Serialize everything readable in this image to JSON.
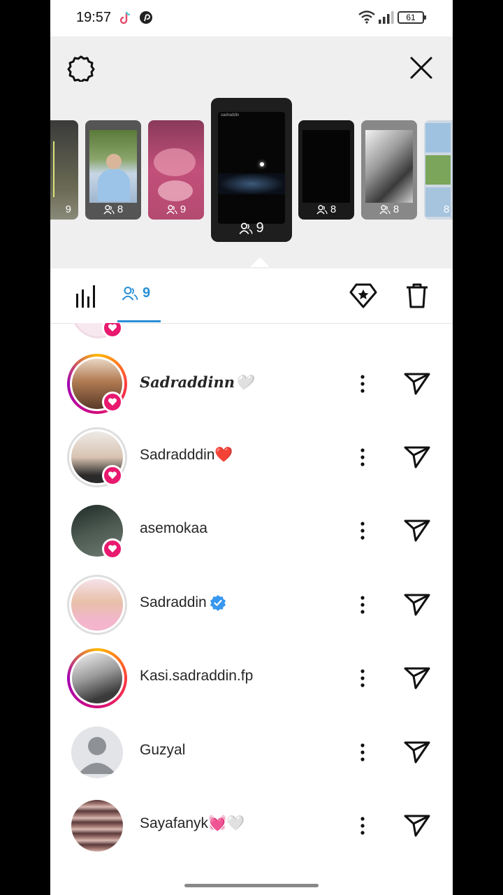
{
  "status_bar": {
    "time": "19:57",
    "battery": "61"
  },
  "stories": [
    {
      "viewers": "9",
      "theme": "night-stage"
    },
    {
      "viewers": "8",
      "theme": "person-blue-hoodie"
    },
    {
      "viewers": "9",
      "theme": "pink-drums"
    },
    {
      "viewers": "9",
      "theme": "dark-night-selected",
      "header": "sadraddin"
    },
    {
      "viewers": "8",
      "theme": "dark"
    },
    {
      "viewers": "8",
      "theme": "bw-photo"
    },
    {
      "viewers": "8",
      "theme": "collage"
    }
  ],
  "tabs": {
    "viewers_count": "9"
  },
  "viewers": [
    {
      "name": "Sadraddinn🤍",
      "ring": "gradient",
      "heart": true,
      "style": "serif",
      "avatar_color": "#8a5a3a"
    },
    {
      "name": "Sadradddin❤️",
      "ring": "gray",
      "heart": true,
      "style": "normal",
      "avatar_color": "#d8d2cc"
    },
    {
      "name": "asemokaa",
      "ring": "none",
      "heart": true,
      "style": "normal",
      "avatar_color": "#3b4640"
    },
    {
      "name": "Sadraddin",
      "ring": "gray",
      "heart": false,
      "verified": true,
      "style": "normal",
      "avatar_color": "#f2c6d6"
    },
    {
      "name": "Kasi.sadraddin.fp",
      "ring": "gradient",
      "heart": false,
      "style": "normal",
      "avatar_color": "#9a9a9a"
    },
    {
      "name": "Guzyal",
      "ring": "none",
      "heart": false,
      "style": "normal",
      "avatar_color": "#d9dbde"
    },
    {
      "name": "Sayafanyk💓🤍",
      "ring": "none",
      "heart": false,
      "style": "normal",
      "avatar_color": "#7a5a5a"
    }
  ],
  "colors": {
    "accent": "#2a8fd6",
    "heart": "#e8196e",
    "verified": "#3897f0"
  }
}
